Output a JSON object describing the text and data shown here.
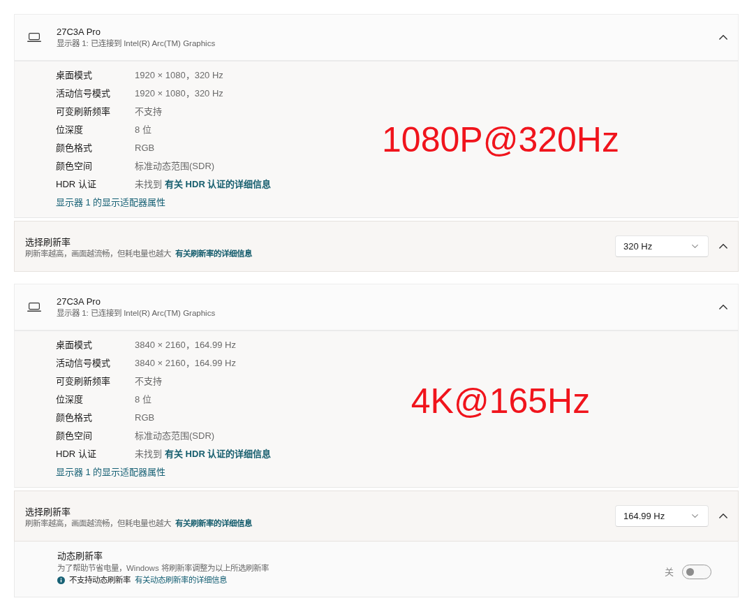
{
  "panels": [
    {
      "display": {
        "name": "27C3A Pro",
        "subtitle": "显示器 1: 已连接到 Intel(R) Arc(TM) Graphics",
        "expanded": true
      },
      "details": [
        {
          "label": "桌面模式",
          "value": "1920 × 1080，320 Hz"
        },
        {
          "label": "活动信号模式",
          "value": "1920 × 1080，320 Hz"
        },
        {
          "label": "可变刷新频率",
          "value": "不支持"
        },
        {
          "label": "位深度",
          "value": "8 位"
        },
        {
          "label": "颜色格式",
          "value": "RGB"
        },
        {
          "label": "颜色空间",
          "value": "标准动态范围(SDR)"
        },
        {
          "label": "HDR 认证",
          "value": "未找到",
          "link": "有关 HDR 认证的详细信息"
        }
      ],
      "adapter_link": "显示器 1 的显示适配器属性",
      "annotation": "1080P@320Hz",
      "refresh_rate": {
        "title": "选择刷新率",
        "description": "刷新率越高，画面越流畅，但耗电量也越大",
        "link": "有关刷新率的详细信息",
        "value": "320 Hz",
        "expanded": true
      }
    },
    {
      "display": {
        "name": "27C3A Pro",
        "subtitle": "显示器 1: 已连接到 Intel(R) Arc(TM) Graphics",
        "expanded": true
      },
      "details": [
        {
          "label": "桌面模式",
          "value": "3840 × 2160，164.99 Hz"
        },
        {
          "label": "活动信号模式",
          "value": "3840 × 2160，164.99 Hz"
        },
        {
          "label": "可变刷新频率",
          "value": "不支持"
        },
        {
          "label": "位深度",
          "value": "8 位"
        },
        {
          "label": "颜色格式",
          "value": "RGB"
        },
        {
          "label": "颜色空间",
          "value": "标准动态范围(SDR)"
        },
        {
          "label": "HDR 认证",
          "value": "未找到",
          "link": "有关 HDR 认证的详细信息"
        }
      ],
      "adapter_link": "显示器 1 的显示适配器属性",
      "annotation": "4K@165Hz",
      "refresh_rate": {
        "title": "选择刷新率",
        "description": "刷新率越高，画面越流畅，但耗电量也越大",
        "link": "有关刷新率的详细信息",
        "value": "164.99 Hz",
        "expanded": true
      },
      "dynamic_refresh": {
        "title": "动态刷新率",
        "description": "为了帮助节省电量，Windows 将刷新率调整为以上所选刷新率",
        "notice": "不支持动态刷新率",
        "link": "有关动态刷新率的详细信息",
        "state_label": "关",
        "on": false
      }
    }
  ]
}
